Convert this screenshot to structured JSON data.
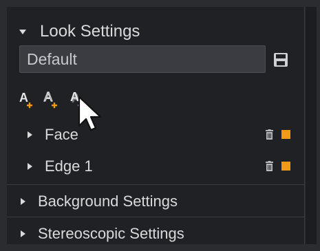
{
  "look_settings": {
    "title": "Look Settings",
    "preset_value": "Default",
    "tools": [
      {
        "icon": "add-text-layer-icon",
        "glyph": "A"
      },
      {
        "icon": "add-outline-layer-icon",
        "glyph": "A"
      },
      {
        "icon": "add-shadow-layer-icon",
        "glyph": "A"
      }
    ],
    "layers": [
      {
        "label": "Face",
        "swatch_color": "#f09a16"
      },
      {
        "label": "Edge 1",
        "swatch_color": "#f09a16"
      }
    ]
  },
  "background_settings": {
    "title": "Background Settings"
  },
  "stereoscopic_settings": {
    "title": "Stereoscopic Settings"
  },
  "colors": {
    "accent": "#f09a16",
    "panel": "#202124",
    "text": "#d9dadc"
  }
}
